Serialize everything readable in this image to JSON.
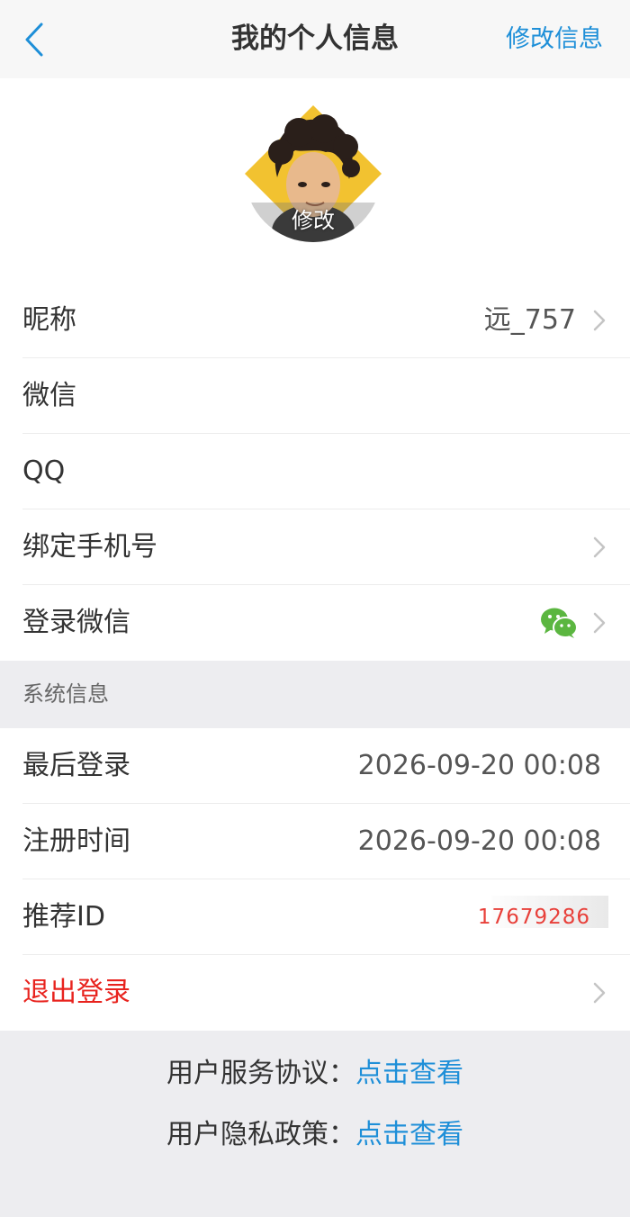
{
  "nav": {
    "title": "我的个人信息",
    "edit_label": "修改信息"
  },
  "avatar": {
    "edit_label": "修改"
  },
  "profile_rows": [
    {
      "label": "昵称",
      "value": "远_757"
    },
    {
      "label": "微信",
      "value": ""
    },
    {
      "label": "QQ",
      "value": ""
    },
    {
      "label": "绑定手机号",
      "value": ""
    },
    {
      "label": "登录微信",
      "value": ""
    }
  ],
  "system_section": {
    "title": "系统信息",
    "last_login_label": "最后登录",
    "last_login_value": "2026-09-20 00:08",
    "register_label": "注册时间",
    "register_value": "2026-09-20 00:08",
    "referral_label": "推荐ID",
    "referral_value": "17679286"
  },
  "logout": {
    "label": "退出登录"
  },
  "footer": {
    "service_prefix": "用户服务协议：",
    "service_link": "点击查看",
    "privacy_prefix": "用户隐私政策：",
    "privacy_link": "点击查看"
  },
  "icons": {
    "back": "chevron-left-icon",
    "chevron": "chevron-right-icon",
    "wechat": "wechat-icon"
  },
  "colors": {
    "accent": "#1e8fd8",
    "danger": "#e8231e",
    "wechat": "#5bb640"
  }
}
